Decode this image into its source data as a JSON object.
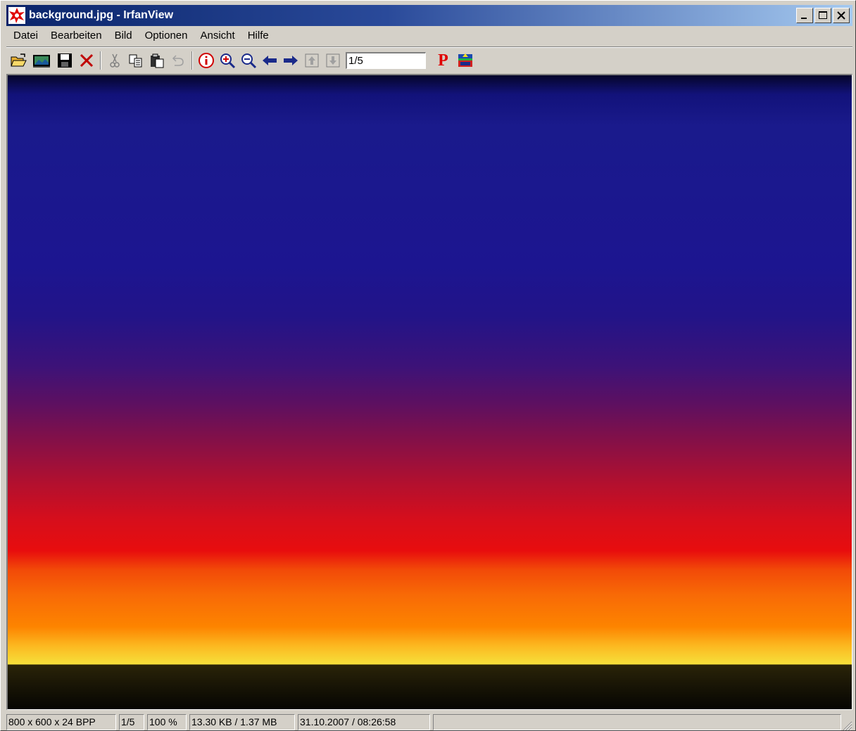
{
  "window": {
    "title": "background.jpg - IrfanView",
    "title_color": "#ffffff",
    "titlebar_gradient": [
      "#0a246a",
      "#a6caf0"
    ]
  },
  "menu": {
    "items": [
      "Datei",
      "Bearbeiten",
      "Bild",
      "Optionen",
      "Ansicht",
      "Hilfe"
    ]
  },
  "toolbar": {
    "page_value": "1/5",
    "p_label": "P",
    "icons": [
      "open-folder-icon",
      "thumbnails-icon",
      "save-icon",
      "delete-icon",
      "cut-icon",
      "copy-icon",
      "paste-icon",
      "undo-icon",
      "info-icon",
      "zoom-in-icon",
      "zoom-out-icon",
      "prev-arrow-icon",
      "next-arrow-icon",
      "first-page-icon",
      "last-page-icon",
      "plugin-p-icon",
      "slideshow-icon"
    ]
  },
  "image": {
    "description_colors": [
      "#12127a",
      "#1c1590",
      "#5e1060",
      "#e80d0e",
      "#fd8400",
      "#f6e03a",
      "#050502"
    ]
  },
  "statusbar": {
    "dimensions": "800 x 600 x 24 BPP",
    "page": "1/5",
    "zoom": "100 %",
    "size": "13.30 KB / 1.37 MB",
    "datetime": "31.10.2007 / 08:26:58"
  }
}
